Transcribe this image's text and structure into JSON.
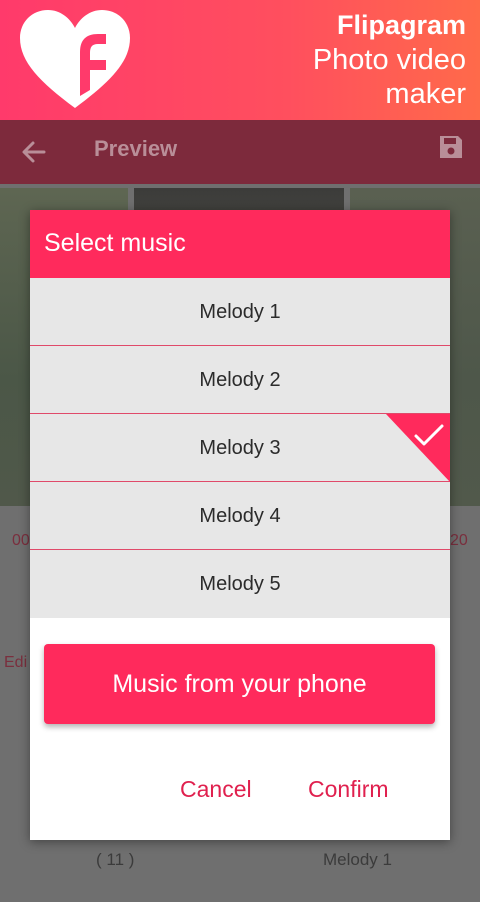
{
  "banner": {
    "title": "Flipagram",
    "subtitle_line1": "Photo video",
    "subtitle_line2": "maker",
    "logo_icon": "heart-f-logo-icon"
  },
  "appbar": {
    "title": "Preview",
    "back_icon": "arrow-left-icon",
    "save_icon": "save-icon"
  },
  "background": {
    "left_time": "00",
    "right_time": "20",
    "edit_label": "Edi",
    "count_label": "( 11 )",
    "music_label": "Melody 1"
  },
  "dialog": {
    "title": "Select music",
    "items": [
      {
        "label": "Melody 1",
        "selected": false
      },
      {
        "label": "Melody 2",
        "selected": false
      },
      {
        "label": "Melody 3",
        "selected": true
      },
      {
        "label": "Melody 4",
        "selected": false
      },
      {
        "label": "Melody 5",
        "selected": false
      }
    ],
    "phone_button": "Music from your phone",
    "cancel": "Cancel",
    "confirm": "Confirm"
  },
  "colors": {
    "accent": "#ff2a5c",
    "list_bg": "#e7e7e7",
    "action_text": "#e0204e"
  }
}
